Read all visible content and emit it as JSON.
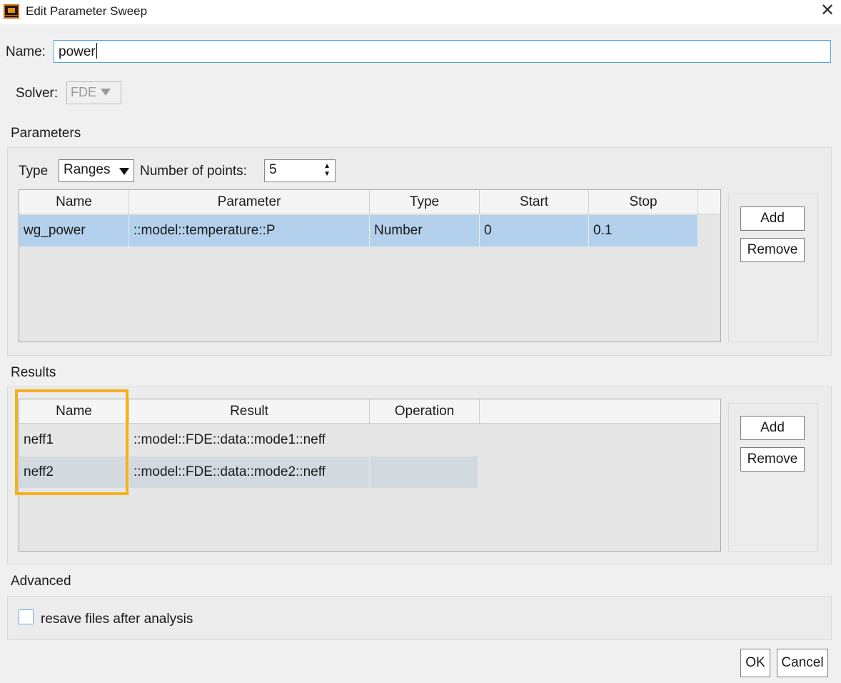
{
  "window": {
    "title": "Edit Parameter Sweep",
    "close_glyph": "✕"
  },
  "name_field": {
    "label": "Name:",
    "value": "power"
  },
  "solver": {
    "label": "Solver:",
    "value": "FDE"
  },
  "parameters": {
    "section_label": "Parameters",
    "type_label": "Type",
    "type_value": "Ranges",
    "points_label": "Number of points:",
    "points_value": "5",
    "columns": [
      "Name",
      "Parameter",
      "Type",
      "Start",
      "Stop"
    ],
    "rows": [
      [
        "wg_power",
        "::model::temperature::P",
        "Number",
        "0",
        "0.1"
      ]
    ],
    "add_label": "Add",
    "remove_label": "Remove"
  },
  "results": {
    "section_label": "Results",
    "columns": [
      "Name",
      "Result",
      "Operation"
    ],
    "rows": [
      [
        "neff1",
        "::model::FDE::data::mode1::neff",
        ""
      ],
      [
        "neff2",
        "::model::FDE::data::mode2::neff",
        ""
      ]
    ],
    "add_label": "Add",
    "remove_label": "Remove"
  },
  "advanced": {
    "section_label": "Advanced",
    "checkbox_label": "resave files after analysis",
    "checked": false
  },
  "footer": {
    "ok_label": "OK",
    "cancel_label": "Cancel"
  },
  "colors": {
    "highlight": "#f5b01d",
    "selection": "#b3d1ec",
    "focus_border": "#4fa6e0"
  }
}
